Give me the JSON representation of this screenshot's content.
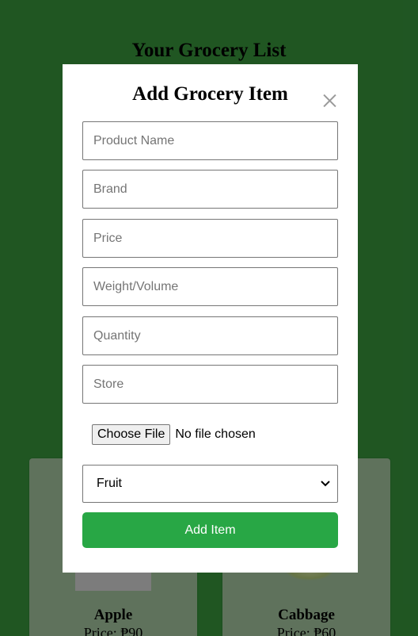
{
  "page": {
    "title": "Your Grocery List"
  },
  "cards": [
    {
      "name": "Apple",
      "price": "Price: ₱90"
    },
    {
      "name": "Cabbage",
      "price": "Price: ₱60"
    }
  ],
  "modal": {
    "title": "Add Grocery Item",
    "close_icon": "close-icon",
    "fields": {
      "product_name": {
        "placeholder": "Product Name",
        "value": ""
      },
      "brand": {
        "placeholder": "Brand",
        "value": ""
      },
      "price": {
        "placeholder": "Price",
        "value": ""
      },
      "weight_volume": {
        "placeholder": "Weight/Volume",
        "value": ""
      },
      "quantity": {
        "placeholder": "Quantity",
        "value": ""
      },
      "store": {
        "placeholder": "Store",
        "value": ""
      }
    },
    "file": {
      "button_label": "Choose File",
      "status": "No file chosen"
    },
    "category": {
      "selected": "Fruit",
      "icon": "chevron-down-icon"
    },
    "submit_label": "Add Item"
  },
  "colors": {
    "background": "#36903a",
    "accent": "#28a745"
  }
}
